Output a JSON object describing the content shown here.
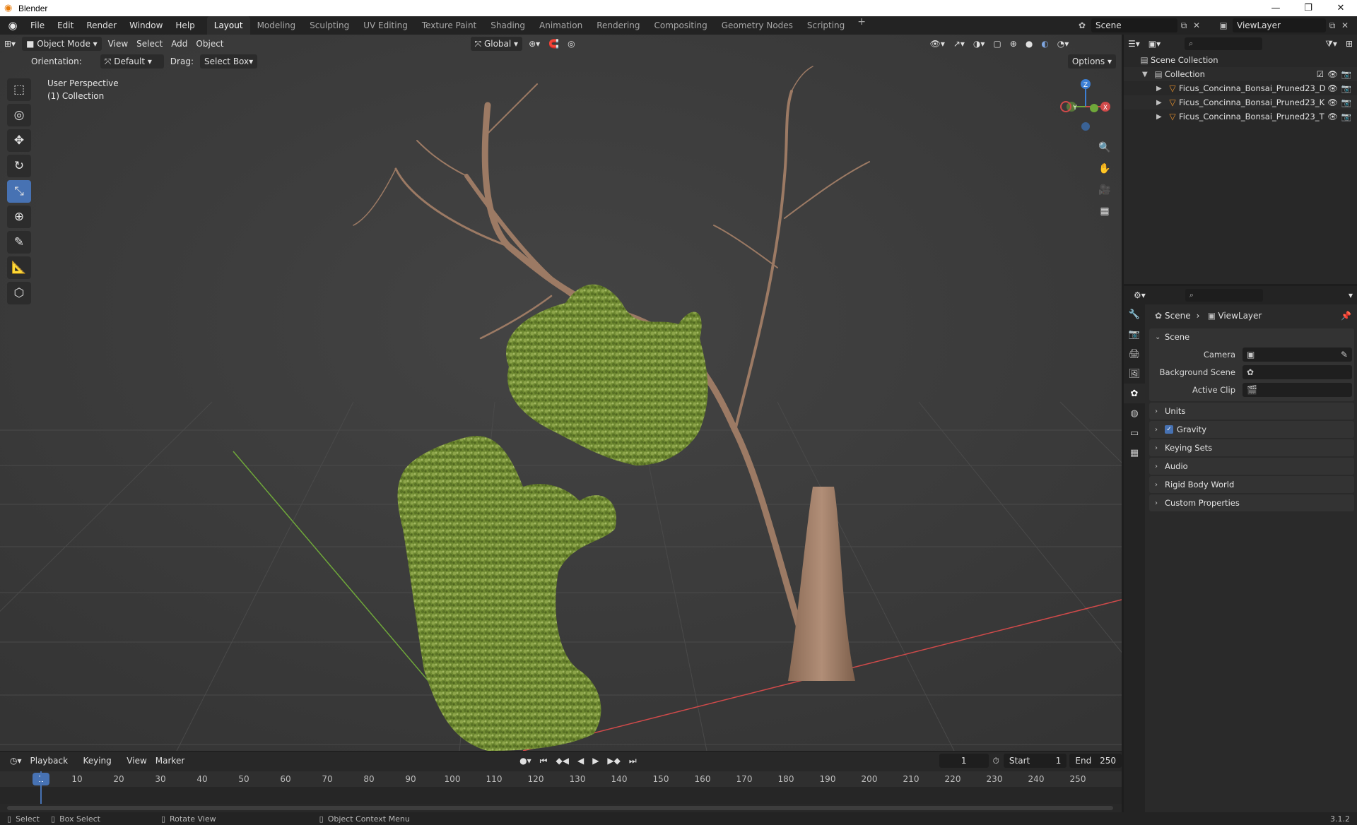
{
  "window": {
    "title": "Blender",
    "controls": [
      "—",
      "❐",
      "✕"
    ]
  },
  "menubar": {
    "items": [
      "File",
      "Edit",
      "Render",
      "Window",
      "Help"
    ],
    "workspaces": [
      "Layout",
      "Modeling",
      "Sculpting",
      "UV Editing",
      "Texture Paint",
      "Shading",
      "Animation",
      "Rendering",
      "Compositing",
      "Geometry Nodes",
      "Scripting"
    ],
    "active_workspace": "Layout",
    "add_tab": "+",
    "scene": "Scene",
    "view_layer": "ViewLayer"
  },
  "viewport": {
    "mode": "Object Mode",
    "menus": [
      "View",
      "Select",
      "Add",
      "Object"
    ],
    "transform_orientation": "Global",
    "orientation_label": "Orientation:",
    "orientation_value": "Default",
    "drag_label": "Drag:",
    "drag_value": "Select Box",
    "options": "Options",
    "overlay_line1": "User Perspective",
    "overlay_line2": "(1) Collection",
    "gizmo": {
      "z": "Z",
      "y": "Y",
      "x": "X"
    }
  },
  "timeline": {
    "menus": [
      "Playback",
      "Keying",
      "View",
      "Marker"
    ],
    "current_frame": "1",
    "start_label": "Start",
    "start_value": "1",
    "end_label": "End",
    "end_value": "250",
    "ruler": [
      "1",
      "10",
      "20",
      "30",
      "40",
      "50",
      "60",
      "70",
      "80",
      "90",
      "100",
      "110",
      "120",
      "130",
      "140",
      "150",
      "160",
      "170",
      "180",
      "190",
      "200",
      "210",
      "220",
      "230",
      "240",
      "250"
    ]
  },
  "statusbar": {
    "select": "Select",
    "box_select": "Box Select",
    "rotate_view": "Rotate View",
    "context_menu": "Object Context Menu",
    "version": "3.1.2"
  },
  "outliner": {
    "root": "Scene Collection",
    "collection": "Collection",
    "objects": [
      "Ficus_Concinna_Bonsai_Pruned23_D",
      "Ficus_Concinna_Bonsai_Pruned23_K",
      "Ficus_Concinna_Bonsai_Pruned23_T"
    ]
  },
  "properties": {
    "breadcrumb_scene": "Scene",
    "breadcrumb_layer": "ViewLayer",
    "panel_scene": "Scene",
    "camera_label": "Camera",
    "background_label": "Background Scene",
    "clip_label": "Active Clip",
    "panels": [
      "Units",
      "Gravity",
      "Keying Sets",
      "Audio",
      "Rigid Body World",
      "Custom Properties"
    ]
  },
  "colors": {
    "accent": "#4772b3",
    "axis_x": "#d04a4a",
    "axis_y": "#6fa83a",
    "axis_z": "#3c7fd4",
    "foliage": "#6f8a32",
    "trunk": "#a37d66"
  }
}
